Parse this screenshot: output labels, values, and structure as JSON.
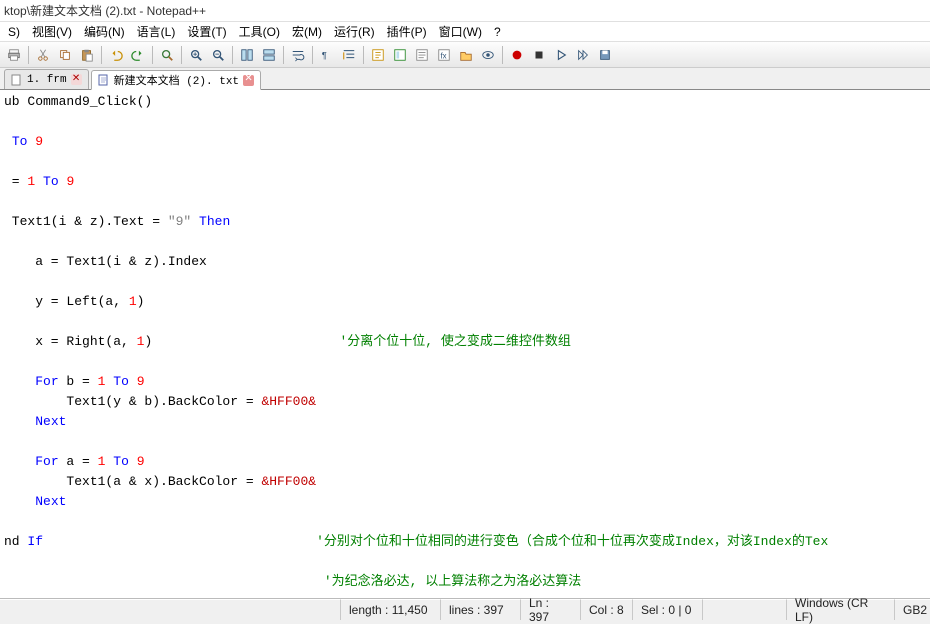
{
  "title": "ktop\\新建文本文档 (2).txt - Notepad++",
  "menu": {
    "items": [
      "S)",
      "视图(V)",
      "编码(N)",
      "语言(L)",
      "设置(T)",
      "工具(O)",
      "宏(M)",
      "运行(R)",
      "插件(P)",
      "窗口(W)",
      "?"
    ]
  },
  "toolbar": {
    "icons": [
      "print-icon",
      "sep",
      "cut-icon",
      "copy-icon",
      "paste-icon",
      "sep",
      "undo-icon",
      "redo-icon",
      "sep",
      "zoom-in-icon",
      "zoom-out-icon",
      "sep",
      "sync-v-icon",
      "sync-h-icon",
      "sep",
      "wordwrap-icon",
      "sep",
      "allchars-icon",
      "indent-icon",
      "sep",
      "lang-icon",
      "doc-map-icon",
      "func-list-icon",
      "folder-workspace-icon",
      "monitor-icon",
      "sep",
      "record-icon",
      "stop-icon",
      "play-icon",
      "playmulti-icon",
      "save-macro-icon"
    ]
  },
  "tabs": {
    "items": [
      {
        "label": "1. frm",
        "active": false
      },
      {
        "label": "新建文本文档 (2). txt",
        "active": true
      }
    ]
  },
  "code": {
    "l1a": "ub ",
    "l1b": "Command9_Click()",
    "l3a": " ",
    "l3b": "To",
    "l3c": " ",
    "l3d": "9",
    "l5a": " = ",
    "l5b": "1",
    "l5c": " ",
    "l5d": "To",
    "l5e": " ",
    "l5f": "9",
    "l7a": " Text1(i & z).Text = ",
    "l7b": "\"9\"",
    "l7c": " ",
    "l7d": "Then",
    "l9": "    a = Text1(i & z).Index",
    "l11": "    y = Left(a, ",
    "l11b": "1",
    "l11c": ")",
    "l13": "    x = Right(a, ",
    "l13b": "1",
    "l13c": ")",
    "cmt1": "'分离个位十位, 使之变成二维控件数组",
    "l15a": "    ",
    "l15b": "For",
    "l15c": " b = ",
    "l15d": "1",
    "l15e": " ",
    "l15f": "To",
    "l15g": " ",
    "l15h": "9",
    "l16a": "        Text1(y & b).BackColor = ",
    "l16b": "&HFF00&",
    "l17a": "    ",
    "l17b": "Next",
    "l19a": "    ",
    "l19b": "For",
    "l19c": " a = ",
    "l19d": "1",
    "l19e": " ",
    "l19f": "To",
    "l19g": " ",
    "l19h": "9",
    "l20a": "        Text1(a & x).BackColor = ",
    "l20b": "&HFF00&",
    "l21a": "    ",
    "l21b": "Next",
    "l23a": "nd ",
    "l23b": "If",
    "cmt2": "'分别对个位和十位相同的进行变色（合成个位和十位再次变成Index，对该Index的Tex",
    "cmt3": "'为纪念洛必达, 以上算法称之为洛必达算法"
  },
  "status": {
    "length": "length : 11,450",
    "lines": "lines : 397",
    "ln": "Ln : 397",
    "col": "Col : 8",
    "sel": "Sel : 0 | 0",
    "eol": "Windows (CR LF)",
    "enc": "GB2"
  }
}
